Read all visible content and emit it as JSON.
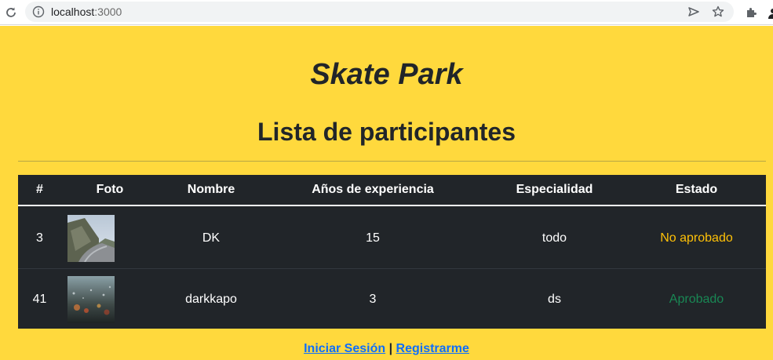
{
  "browser": {
    "url_host": "localhost",
    "url_port": ":3000"
  },
  "page": {
    "site_title": "Skate Park",
    "list_title": "Lista de participantes"
  },
  "table": {
    "headers": [
      "#",
      "Foto",
      "Nombre",
      "Años de experiencia",
      "Especialidad",
      "Estado"
    ],
    "rows": [
      {
        "id": "3",
        "name": "DK",
        "years": "15",
        "specialty": "todo",
        "status": "No aprobado"
      },
      {
        "id": "41",
        "name": "darkkapo",
        "years": "3",
        "specialty": "ds",
        "status": "Aprobado"
      }
    ]
  },
  "footer": {
    "login": "Iniciar Sesión",
    "separator": "|",
    "register": "Registrarme"
  },
  "colors": {
    "page_background": "#ffd93d",
    "table_background": "#212529",
    "status_pending": "#ffc107",
    "status_approved": "#198754",
    "link": "#0d6efd"
  }
}
